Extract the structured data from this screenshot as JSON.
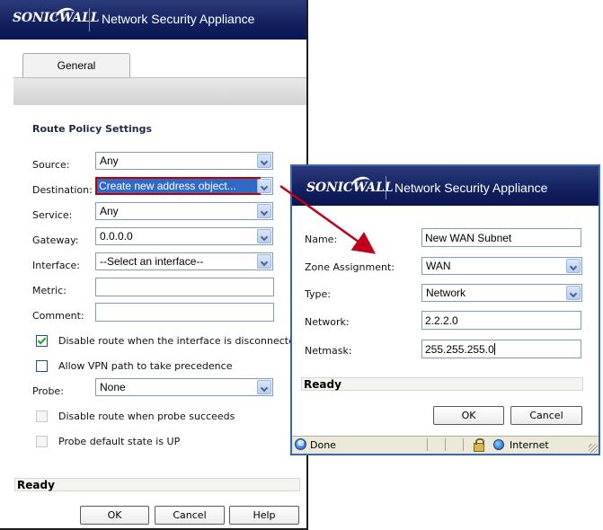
{
  "brand": {
    "logo_text": "SONICWALL",
    "app_title": "Network Security Appliance",
    "banner_color": "#12205f",
    "highlight_color": "#c00000",
    "arrow_color": "#c0001a"
  },
  "main": {
    "tab_label": "General",
    "section_title": "Route Policy Settings",
    "fields": {
      "source_label": "Source:",
      "source_value": "Any",
      "destination_label": "Destination:",
      "destination_value": "Create new address object...",
      "service_label": "Service:",
      "service_value": "Any",
      "gateway_label": "Gateway:",
      "gateway_value": "0.0.0.0",
      "interface_label": "Interface:",
      "interface_value": "--Select an interface--",
      "metric_label": "Metric:",
      "metric_value": "",
      "comment_label": "Comment:",
      "comment_value": "",
      "probe_label": "Probe:",
      "probe_value": "None"
    },
    "checkboxes": {
      "disable_route_label": "Disable route when the interface is disconnected",
      "allow_vpn_label": "Allow VPN path to take precedence",
      "disable_probe_label": "Disable route when probe succeeds",
      "probe_default_label": "Probe default state is UP"
    },
    "status_text": "Ready",
    "buttons": {
      "ok": "OK",
      "cancel": "Cancel",
      "help": "Help"
    }
  },
  "popup": {
    "fields": {
      "name_label": "Name:",
      "name_value": "New WAN Subnet",
      "zone_label": "Zone Assignment:",
      "zone_value": "WAN",
      "type_label": "Type:",
      "type_value": "Network",
      "network_label": "Network:",
      "network_value": "2.2.2.0",
      "netmask_label": "Netmask:",
      "netmask_value": "255.255.255.0"
    },
    "status_text": "Ready",
    "buttons": {
      "ok": "OK",
      "cancel": "Cancel"
    },
    "browser_status": {
      "left_text": "Done",
      "zone_text": "Internet"
    }
  }
}
